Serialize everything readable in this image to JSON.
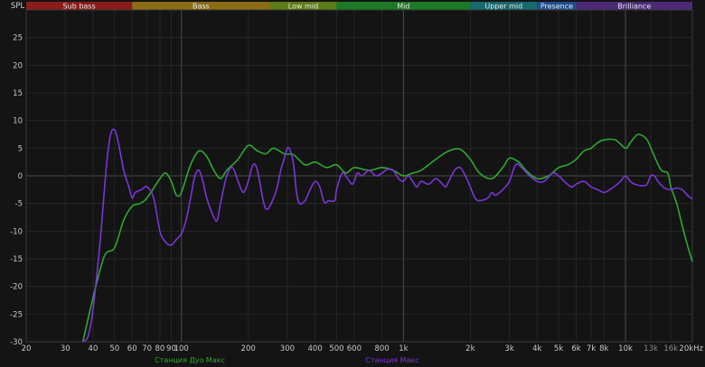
{
  "chart_data": {
    "type": "line",
    "ylabel": "SPL",
    "x_unit": "Hz",
    "x_scale": "log",
    "xlim": [
      20,
      20000
    ],
    "ylim": [
      -30,
      30
    ],
    "grid": true,
    "y_ticks": [
      25,
      20,
      15,
      10,
      5,
      0,
      -5,
      -10,
      -15,
      -20,
      -25,
      -30
    ],
    "x_ticks": [
      {
        "value": 20,
        "label": "20",
        "major": true
      },
      {
        "value": 30,
        "label": "30",
        "major": true
      },
      {
        "value": 40,
        "label": "40",
        "major": true
      },
      {
        "value": 50,
        "label": "50",
        "major": true
      },
      {
        "value": 60,
        "label": "60",
        "major": true
      },
      {
        "value": 70,
        "label": "70",
        "major": true
      },
      {
        "value": 80,
        "label": "80",
        "major": true
      },
      {
        "value": 90,
        "label": "90",
        "major": true
      },
      {
        "value": 100,
        "label": "100",
        "major": true
      },
      {
        "value": 200,
        "label": "200",
        "major": true
      },
      {
        "value": 300,
        "label": "300",
        "major": true
      },
      {
        "value": 400,
        "label": "400",
        "major": true
      },
      {
        "value": 500,
        "label": "500",
        "major": true
      },
      {
        "value": 600,
        "label": "600",
        "major": true
      },
      {
        "value": 800,
        "label": "800",
        "major": true
      },
      {
        "value": 1000,
        "label": "1k",
        "major": true
      },
      {
        "value": 2000,
        "label": "2k",
        "major": true
      },
      {
        "value": 3000,
        "label": "3k",
        "major": true
      },
      {
        "value": 4000,
        "label": "4k",
        "major": true
      },
      {
        "value": 5000,
        "label": "5k",
        "major": true
      },
      {
        "value": 6000,
        "label": "6k",
        "major": true
      },
      {
        "value": 7000,
        "label": "7k",
        "major": true
      },
      {
        "value": 8000,
        "label": "8k",
        "major": true
      },
      {
        "value": 10000,
        "label": "10k",
        "major": true
      },
      {
        "value": 13000,
        "label": "13k",
        "major": false
      },
      {
        "value": 16000,
        "label": "16k",
        "major": false
      },
      {
        "value": 20000,
        "label": "20kHz",
        "major": true
      }
    ],
    "bands": [
      {
        "label": "Sub bass",
        "from": 20,
        "to": 60,
        "color": "#8c1c1c"
      },
      {
        "label": "Bass",
        "from": 60,
        "to": 250,
        "color": "#8a6d14"
      },
      {
        "label": "Low mid",
        "from": 250,
        "to": 500,
        "color": "#5e7d18"
      },
      {
        "label": "Mid",
        "from": 500,
        "to": 2000,
        "color": "#1c7a24"
      },
      {
        "label": "Upper mid",
        "from": 2000,
        "to": 4000,
        "color": "#176a6e"
      },
      {
        "label": "Presence",
        "from": 4000,
        "to": 6000,
        "color": "#1f4d8f"
      },
      {
        "label": "Brilliance",
        "from": 6000,
        "to": 20000,
        "color": "#4d2a78"
      }
    ],
    "series": [
      {
        "name": "Станция Дуо Макс",
        "color": "#2ea82e",
        "points": [
          [
            36,
            -30
          ],
          [
            40,
            -22
          ],
          [
            45,
            -14.5
          ],
          [
            50,
            -13
          ],
          [
            55,
            -8
          ],
          [
            60,
            -5.5
          ],
          [
            65,
            -5
          ],
          [
            70,
            -4
          ],
          [
            80,
            -0.5
          ],
          [
            85,
            0.5
          ],
          [
            90,
            -1
          ],
          [
            95,
            -3.5
          ],
          [
            100,
            -3
          ],
          [
            110,
            2
          ],
          [
            120,
            4.5
          ],
          [
            130,
            3.5
          ],
          [
            140,
            1
          ],
          [
            150,
            -0.5
          ],
          [
            160,
            1
          ],
          [
            180,
            3
          ],
          [
            200,
            5.5
          ],
          [
            220,
            4.5
          ],
          [
            240,
            4
          ],
          [
            260,
            5
          ],
          [
            290,
            4
          ],
          [
            320,
            3.8
          ],
          [
            360,
            2
          ],
          [
            400,
            2.5
          ],
          [
            450,
            1.5
          ],
          [
            500,
            2
          ],
          [
            550,
            0.5
          ],
          [
            600,
            1.5
          ],
          [
            700,
            1
          ],
          [
            800,
            1.5
          ],
          [
            900,
            1
          ],
          [
            1000,
            0
          ],
          [
            1100,
            0.5
          ],
          [
            1200,
            1
          ],
          [
            1400,
            3
          ],
          [
            1600,
            4.5
          ],
          [
            1800,
            4.8
          ],
          [
            2000,
            3
          ],
          [
            2200,
            0.5
          ],
          [
            2500,
            -0.5
          ],
          [
            2800,
            1.5
          ],
          [
            3000,
            3.2
          ],
          [
            3300,
            2.5
          ],
          [
            3600,
            0.8
          ],
          [
            4000,
            -0.5
          ],
          [
            4500,
            0
          ],
          [
            5000,
            1.5
          ],
          [
            5500,
            2
          ],
          [
            6000,
            3
          ],
          [
            6500,
            4.5
          ],
          [
            7000,
            5
          ],
          [
            7500,
            6
          ],
          [
            8000,
            6.5
          ],
          [
            9000,
            6.5
          ],
          [
            10000,
            5
          ],
          [
            10500,
            6
          ],
          [
            11000,
            7
          ],
          [
            11500,
            7.5
          ],
          [
            12500,
            6.5
          ],
          [
            13500,
            3.5
          ],
          [
            14500,
            1
          ],
          [
            15500,
            0.5
          ],
          [
            16000,
            -2
          ],
          [
            17000,
            -5
          ],
          [
            18000,
            -9
          ],
          [
            19000,
            -12.5
          ],
          [
            20000,
            -15.5
          ]
        ]
      },
      {
        "name": "Станция Макс",
        "color": "#7b35d6",
        "points": [
          [
            36,
            -30
          ],
          [
            38,
            -29
          ],
          [
            40,
            -24
          ],
          [
            43,
            -12
          ],
          [
            46,
            2
          ],
          [
            48,
            7.5
          ],
          [
            50,
            8.3
          ],
          [
            52,
            6
          ],
          [
            55,
            1
          ],
          [
            58,
            -2
          ],
          [
            60,
            -4
          ],
          [
            62,
            -3
          ],
          [
            66,
            -2.5
          ],
          [
            70,
            -2
          ],
          [
            75,
            -4
          ],
          [
            80,
            -10
          ],
          [
            85,
            -12
          ],
          [
            90,
            -12.5
          ],
          [
            95,
            -11.5
          ],
          [
            100,
            -10.5
          ],
          [
            105,
            -8
          ],
          [
            110,
            -4
          ],
          [
            115,
            0
          ],
          [
            120,
            1
          ],
          [
            125,
            -1
          ],
          [
            130,
            -4
          ],
          [
            140,
            -7.5
          ],
          [
            145,
            -8
          ],
          [
            150,
            -5
          ],
          [
            160,
            0
          ],
          [
            170,
            1.5
          ],
          [
            180,
            -1
          ],
          [
            190,
            -3
          ],
          [
            200,
            -1
          ],
          [
            210,
            2
          ],
          [
            220,
            1
          ],
          [
            235,
            -5
          ],
          [
            245,
            -6
          ],
          [
            260,
            -4
          ],
          [
            270,
            -2
          ],
          [
            280,
            1
          ],
          [
            290,
            3
          ],
          [
            300,
            5
          ],
          [
            310,
            4.5
          ],
          [
            320,
            2
          ],
          [
            330,
            -3
          ],
          [
            340,
            -5
          ],
          [
            360,
            -4.5
          ],
          [
            380,
            -2.5
          ],
          [
            400,
            -1
          ],
          [
            420,
            -2
          ],
          [
            440,
            -4.8
          ],
          [
            460,
            -4.5
          ],
          [
            490,
            -4.5
          ],
          [
            500,
            -2.5
          ],
          [
            530,
            0.5
          ],
          [
            560,
            -0.5
          ],
          [
            590,
            -1.5
          ],
          [
            620,
            0.5
          ],
          [
            650,
            0
          ],
          [
            700,
            1
          ],
          [
            750,
            0
          ],
          [
            800,
            0.5
          ],
          [
            850,
            1.2
          ],
          [
            900,
            1
          ],
          [
            950,
            -0.5
          ],
          [
            1000,
            -1
          ],
          [
            1050,
            0
          ],
          [
            1100,
            -1
          ],
          [
            1150,
            -2
          ],
          [
            1200,
            -1
          ],
          [
            1300,
            -1.5
          ],
          [
            1400,
            -0.5
          ],
          [
            1500,
            -1.5
          ],
          [
            1550,
            -2
          ],
          [
            1600,
            -1
          ],
          [
            1700,
            1
          ],
          [
            1800,
            1.5
          ],
          [
            1900,
            0
          ],
          [
            2000,
            -2
          ],
          [
            2100,
            -4
          ],
          [
            2200,
            -4.5
          ],
          [
            2400,
            -4
          ],
          [
            2500,
            -3
          ],
          [
            2600,
            -3.5
          ],
          [
            2800,
            -2.5
          ],
          [
            3000,
            -1
          ],
          [
            3200,
            2
          ],
          [
            3400,
            1.5
          ],
          [
            3700,
            0
          ],
          [
            4000,
            -1
          ],
          [
            4300,
            -1
          ],
          [
            4700,
            0.5
          ],
          [
            5000,
            0
          ],
          [
            5300,
            -1
          ],
          [
            5700,
            -2
          ],
          [
            6000,
            -1.5
          ],
          [
            6500,
            -1
          ],
          [
            7000,
            -2
          ],
          [
            7500,
            -2.5
          ],
          [
            8000,
            -3
          ],
          [
            8500,
            -2.5
          ],
          [
            9000,
            -1.8
          ],
          [
            9500,
            -1
          ],
          [
            10000,
            0
          ],
          [
            10500,
            -1
          ],
          [
            11000,
            -1.5
          ],
          [
            12000,
            -1.8
          ],
          [
            12500,
            -1.5
          ],
          [
            13000,
            0
          ],
          [
            13500,
            0
          ],
          [
            14000,
            -1
          ],
          [
            15000,
            -2.2
          ],
          [
            16000,
            -2.5
          ],
          [
            17000,
            -2.2
          ],
          [
            18000,
            -2.5
          ],
          [
            19000,
            -3.5
          ],
          [
            20000,
            -4.2
          ]
        ]
      }
    ]
  }
}
